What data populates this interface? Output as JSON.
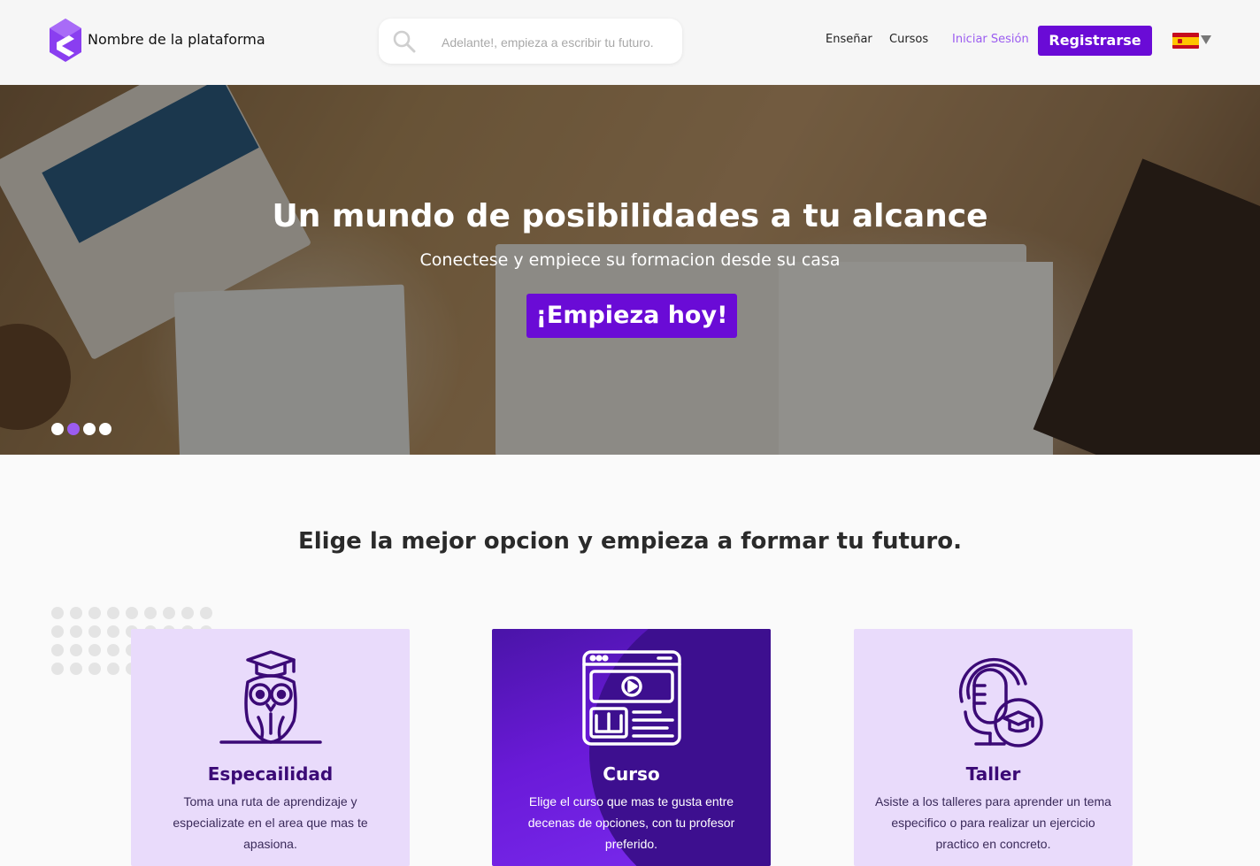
{
  "header": {
    "brand": "Nombre de la plataforma",
    "search_placeholder": "Adelante!, empieza a escribir tu futuro.",
    "nav": {
      "teach": "Enseñar",
      "courses": "Cursos",
      "login": "Iniciar Sesión"
    },
    "register": "Registrarse",
    "language_icon": "spain-flag-icon"
  },
  "hero": {
    "title": "Un mundo de posibilidades a tu alcance",
    "subtitle": "Conectese y empiece su formacion desde su casa",
    "cta": "¡Empieza hoy!",
    "slides_total": 4,
    "active_slide": 2
  },
  "section": {
    "title": "Elige la mejor opcion y empieza a formar tu futuro."
  },
  "cards": [
    {
      "icon": "owl-graduate-icon",
      "title": "Especailidad",
      "description": "Toma una ruta de aprendizaje y especializate en el area que mas te apasiona."
    },
    {
      "icon": "video-course-icon",
      "title": "Curso",
      "description": "Elige el curso que mas te gusta entre decenas de opciones, con tu profesor preferido."
    },
    {
      "icon": "microphone-graduate-icon",
      "title": "Taller",
      "description": "Asiste a los talleres para aprender un tema especifico o para realizar un ejercicio practico en concreto."
    }
  ],
  "colors": {
    "primary": "#6a0bd6",
    "accent": "#9b5cf0",
    "card_light": "#e9dbfb",
    "card_text": "#3b0a76"
  }
}
